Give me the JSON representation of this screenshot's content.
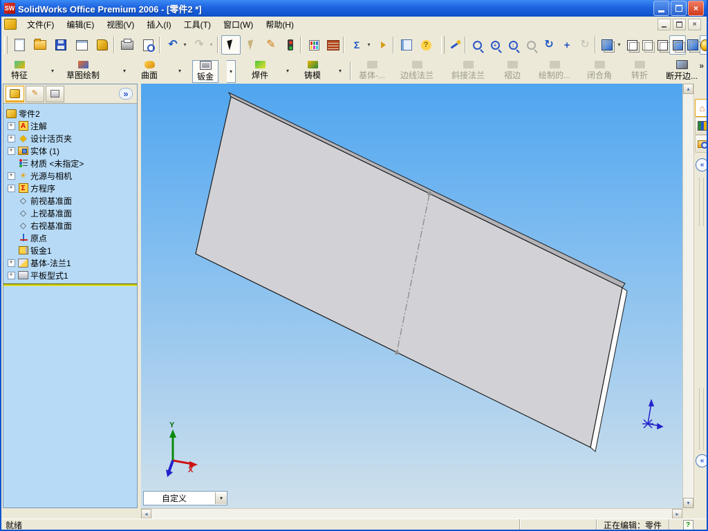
{
  "window": {
    "title": "SolidWorks Office Premium 2006 - [零件2 *]"
  },
  "menu": {
    "items": [
      "文件(F)",
      "编辑(E)",
      "视图(V)",
      "插入(I)",
      "工具(T)",
      "窗口(W)",
      "帮助(H)"
    ]
  },
  "command_manager": {
    "tabs": [
      "特征",
      "草图绘制",
      "曲面",
      "钣金",
      "焊件",
      "铸模"
    ],
    "active_tab": "钣金",
    "commands": [
      "基体-...",
      "边线法兰",
      "斜接法兰",
      "褶边",
      "绘制的...",
      "闭合角",
      "转折",
      "断开边..."
    ],
    "commands_enabled": [
      false,
      false,
      false,
      false,
      false,
      false,
      false,
      true
    ]
  },
  "feature_tree": {
    "root_label": "零件2",
    "items": [
      {
        "label": "注解",
        "expandable": true
      },
      {
        "label": "设计活页夹",
        "expandable": true
      },
      {
        "label": "实体 (1)",
        "expandable": true
      },
      {
        "label": "材质 <未指定>",
        "expandable": false
      },
      {
        "label": "光源与相机",
        "expandable": true
      },
      {
        "label": "方程序",
        "expandable": true
      },
      {
        "label": "前视基准面",
        "expandable": false
      },
      {
        "label": "上视基准面",
        "expandable": false
      },
      {
        "label": "右视基准面",
        "expandable": false
      },
      {
        "label": "原点",
        "expandable": false
      },
      {
        "label": "钣金1",
        "expandable": false
      },
      {
        "label": "基体-法兰1",
        "expandable": true
      },
      {
        "label": "平板型式1",
        "expandable": true
      }
    ]
  },
  "viewport": {
    "view_combo_value": "自定义",
    "triad": {
      "x_label": "X",
      "y_label": "Y"
    },
    "background_top": "#4FA5EF",
    "background_bottom": "#CFE0EC",
    "part_face_color": "#D2D2D6",
    "part_top_band_color": "#B4B3B8",
    "part_edge_strip_color": "#FBFBFB"
  },
  "status_bar": {
    "ready": "就绪",
    "editing": "正在编辑：零件"
  },
  "glyphs": {
    "dropdown": "▾",
    "chevron_right": "»",
    "chevron_left": "«",
    "undo": "↶",
    "redo": "↷",
    "help": "?",
    "sigma": "Σ",
    "sun": "☀",
    "home": "⌂",
    "pencil": "✎",
    "rotate": "↻",
    "pan": "+",
    "up": "▴",
    "down": "▾",
    "left": "◂",
    "right": "▸",
    "close": "×",
    "plus": "+",
    "minus": "−",
    "question": "?",
    "diamond": "◆",
    "plane": "◇",
    "zoom_updown": "↕",
    "letter_a": "A"
  }
}
